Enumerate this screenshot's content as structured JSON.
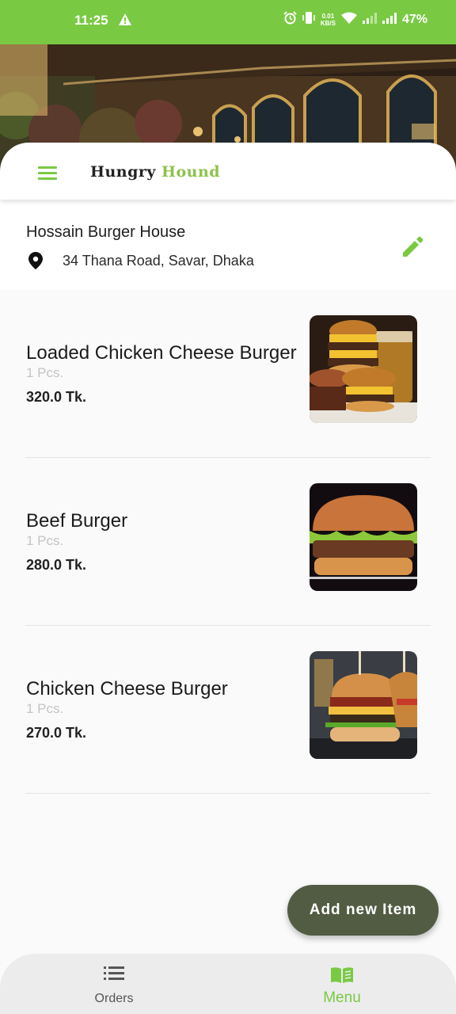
{
  "status_bar": {
    "time": "11:25",
    "speed_value": "0.01",
    "speed_unit": "KB/S",
    "battery": "47%"
  },
  "app_bar": {
    "brand_part1": "Hungry",
    "brand_part2": "Hound"
  },
  "store": {
    "name": "Hossain Burger House",
    "address": "34 Thana Road, Savar, Dhaka"
  },
  "items": [
    {
      "name": "Loaded Chicken Cheese Burger",
      "quantity": "1 Pcs.",
      "price": "320.0 Tk."
    },
    {
      "name": "Beef Burger",
      "quantity": "1 Pcs.",
      "price": "280.0 Tk."
    },
    {
      "name": "Chicken Cheese Burger",
      "quantity": "1 Pcs.",
      "price": "270.0 Tk."
    }
  ],
  "fab": {
    "label": "Add new Item"
  },
  "bottom_nav": {
    "items": [
      {
        "label": "Orders",
        "icon": "list-icon",
        "active": false
      },
      {
        "label": "Menu",
        "icon": "menu-book-icon",
        "active": true
      }
    ]
  },
  "colors": {
    "accent": "#7ac943",
    "fab": "#525c43",
    "brand_second": "#8bc34a"
  }
}
